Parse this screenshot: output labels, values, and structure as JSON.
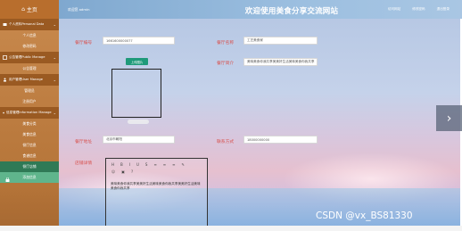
{
  "sidebar": {
    "home": "主页",
    "groups": [
      {
        "label": "个人资料Personal Data",
        "items": [
          "个人信息",
          "修改密码"
        ]
      },
      {
        "label": "公告管理Public Manage",
        "items": [
          "公告管理"
        ]
      },
      {
        "label": "用户管理User Manage",
        "items": [
          "管理员",
          "注册用户"
        ]
      },
      {
        "label": "信息管理Information Manage",
        "items": [
          "美食分类",
          "美食信息",
          "餐厅信息",
          "食谱信息",
          "餐厅店铺",
          "添加信息"
        ]
      }
    ]
  },
  "topbar": {
    "left_text": "欢迎您 admin",
    "title": "欢迎使用美食分享交流网站",
    "links": [
      "访问网站",
      "修改密码",
      "退出登录"
    ]
  },
  "form": {
    "shop_no_label": "餐厅编号",
    "shop_no_value": "1661600000077",
    "shop_name_label": "餐厅名称",
    "shop_name_value": "工艺美食家",
    "upload_label": "上传图片",
    "shop_intro_label": "餐厅简介",
    "shop_intro_value": "美味美食你我共享美美好生活美味美食你我共享",
    "shop_addr_label": "餐厅地址",
    "shop_addr_value": "北京市朝阳",
    "contact_label": "联系方式",
    "contact_value": "18000000000",
    "detail_label": "店铺详情",
    "editor_toolbar_1": [
      "H",
      "B",
      "I",
      "U",
      "S",
      "≡",
      "≡",
      "≡",
      "✎"
    ],
    "editor_toolbar_2": [
      "☺",
      "▣",
      "?"
    ],
    "editor_content": "美味美食你我共享美美好生活美味美食你我共享美美好生活美味美食你我共享"
  },
  "nav_arrow": "›",
  "watermark": "CSDN @vx_BS81330",
  "colors": {
    "sidebar": "#b06f33",
    "active_item": "#2f7a56",
    "label_red": "#d9534f",
    "upload_btn": "#1f9a7a"
  }
}
